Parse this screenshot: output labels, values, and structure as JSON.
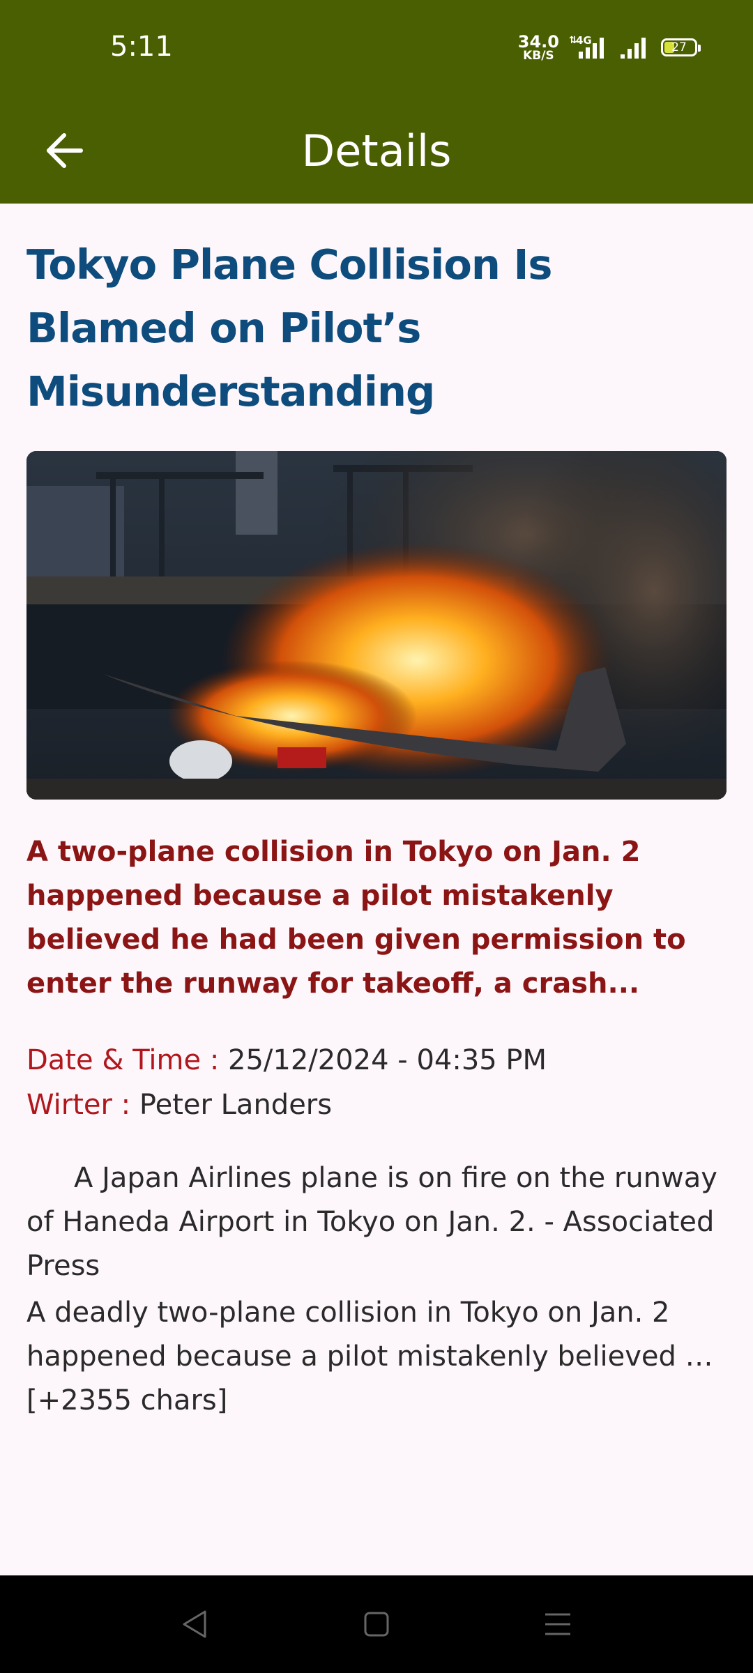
{
  "status_bar": {
    "time": "5:11",
    "net_speed_value": "34.0",
    "net_speed_unit": "KB/S",
    "network_type": "4G",
    "battery_level": "27"
  },
  "app_bar": {
    "title": "Details",
    "back_icon": "arrow-left-icon"
  },
  "article": {
    "headline": "Tokyo Plane Collision Is Blamed on Pilot’s Misunderstanding",
    "image_icon": "burning-plane-photo",
    "summary": "A two-plane collision in Tokyo on Jan. 2 happened because a pilot mistakenly believed he had been given permission to enter the runway for takeoff, a crash...",
    "date_label": "Date & Time :",
    "date_value": "25/12/2024 - 04:35 PM",
    "writer_label": "Wirter :",
    "writer_value": "Peter Landers",
    "body_p1": "A Japan Airlines plane is on fire on the runway of Haneda Airport in Tokyo on Jan. 2. - Associated Press",
    "body_p2": "A deadly two-plane collision in Tokyo on Jan. 2 happened because a pilot mistakenly believed … [+2355 chars]"
  },
  "nav_bar": {
    "back_icon": "triangle-back-icon",
    "home_icon": "square-home-icon",
    "menu_icon": "hamburger-menu-icon"
  },
  "colors": {
    "app_bar": "#4a5e02",
    "headline": "#0d4c7c",
    "summary": "#8b1414",
    "label": "#b0171d",
    "background": "#fdf7fb"
  }
}
